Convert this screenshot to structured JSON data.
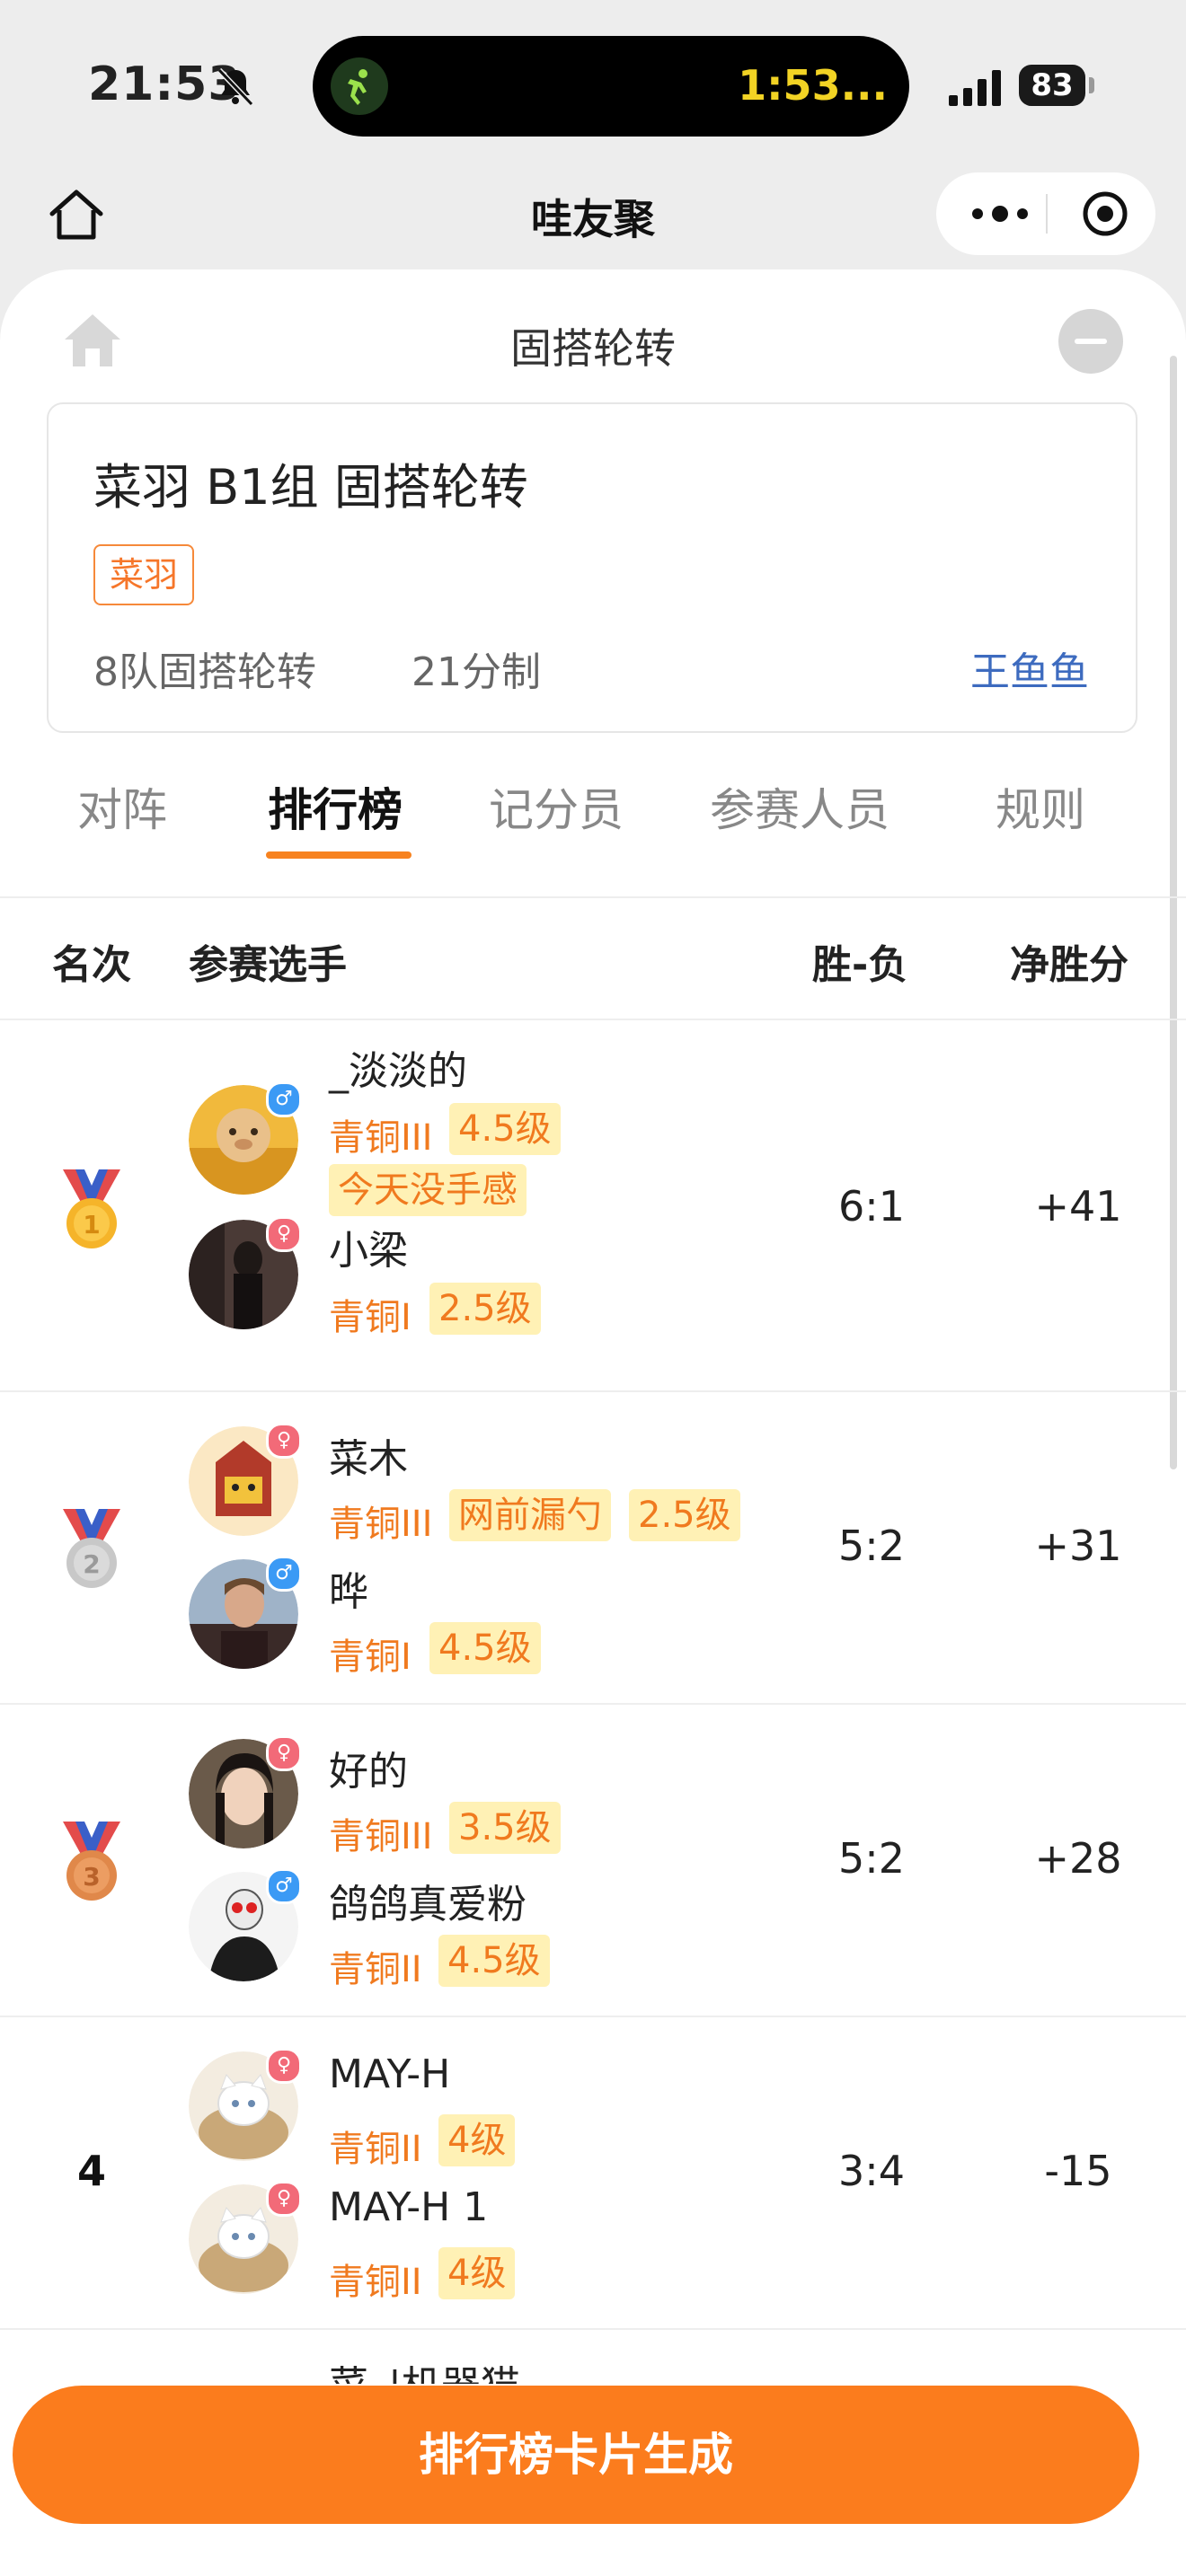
{
  "status_bar": {
    "time": "21:53",
    "timer": "1:53...",
    "battery": "83"
  },
  "mp_nav": {
    "title": "哇友聚"
  },
  "page": {
    "title": "固搭轮转"
  },
  "event": {
    "name": "菜羽 B1组 固搭轮转",
    "sport_tag": "菜羽",
    "format": "8队固搭轮转",
    "scoring": "21分制",
    "organizer": "王鱼鱼"
  },
  "tabs": [
    {
      "label": "对阵"
    },
    {
      "label": "排行榜"
    },
    {
      "label": "记分员"
    },
    {
      "label": "参赛人员"
    },
    {
      "label": "规则"
    }
  ],
  "table": {
    "headers": {
      "rank": "名次",
      "players": "参赛选手",
      "wl": "胜-负",
      "net": "净胜分"
    },
    "rows": [
      {
        "rank": "1",
        "medal": "gold",
        "wl": "6:1",
        "net": "+41",
        "players": [
          {
            "name": "_淡淡的",
            "gender": "male",
            "tier": "青铜III",
            "tags": [
              "4.5级"
            ],
            "extra_tag": "今天没手感"
          },
          {
            "name": "小梁",
            "gender": "female",
            "tier": "青铜I",
            "tags": [
              "2.5级"
            ]
          }
        ]
      },
      {
        "rank": "2",
        "medal": "silver",
        "wl": "5:2",
        "net": "+31",
        "players": [
          {
            "name": "菜木",
            "gender": "female",
            "tier": "青铜III",
            "tags": [
              "网前漏勺",
              "2.5级"
            ]
          },
          {
            "name": "晔",
            "gender": "male",
            "tier": "青铜I",
            "tags": [
              "4.5级"
            ]
          }
        ]
      },
      {
        "rank": "3",
        "medal": "bronze",
        "wl": "5:2",
        "net": "+28",
        "players": [
          {
            "name": "好的",
            "gender": "female",
            "tier": "青铜III",
            "tags": [
              "3.5级"
            ]
          },
          {
            "name": "鸽鸽真爱粉",
            "gender": "male",
            "tier": "青铜II",
            "tags": [
              "4.5级"
            ]
          }
        ]
      },
      {
        "rank": "4",
        "medal": "",
        "wl": "3:4",
        "net": "-15",
        "players": [
          {
            "name": "MAY-H",
            "gender": "female",
            "tier": "青铜II",
            "tags": [
              "4级"
            ]
          },
          {
            "name": "MAY-H 1",
            "gender": "female",
            "tier": "青铜II",
            "tags": [
              "4级"
            ]
          }
        ]
      }
    ],
    "next_row_partial_name": "菜_|机器猫"
  },
  "cta": {
    "label": "排行榜卡片生成"
  },
  "colors": {
    "accent": "#fb7c1d",
    "tag_bg": "#fff1b5",
    "link": "#3d6bbf"
  }
}
